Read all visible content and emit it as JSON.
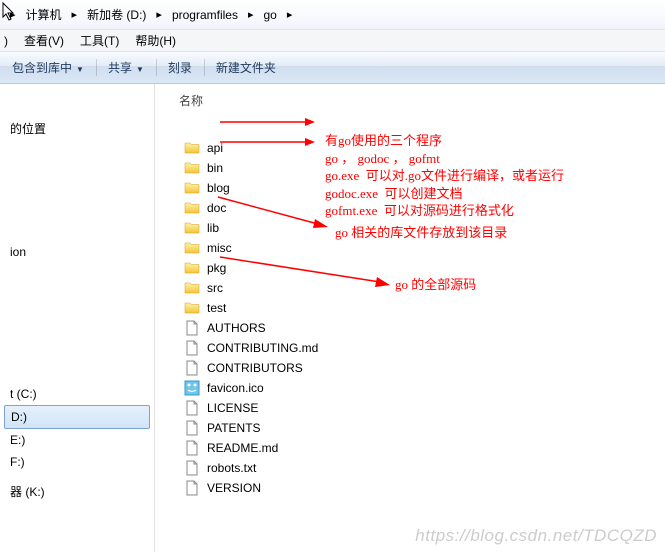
{
  "breadcrumb": [
    {
      "label": "计算机"
    },
    {
      "label": "新加卷 (D:)"
    },
    {
      "label": "programfiles"
    },
    {
      "label": "go"
    }
  ],
  "menubar": {
    "view": "查看(V)",
    "tools": "工具(T)",
    "help": "帮助(H)"
  },
  "toolbar": {
    "include": "包含到库中",
    "share": "共享",
    "burn": "刻录",
    "newfolder": "新建文件夹"
  },
  "sidebar": {
    "items": [
      {
        "label": "的位置",
        "indent": 0
      },
      {
        "label": "ion",
        "indent": 0
      },
      {
        "label": "t (C:)",
        "indent": 0
      },
      {
        "label": "D:)",
        "indent": 0,
        "selected": true
      },
      {
        "label": "E:)",
        "indent": 0
      },
      {
        "label": "F:)",
        "indent": 0
      },
      {
        "label": "器 (K:)",
        "indent": 0
      }
    ]
  },
  "column_header": "名称",
  "files": [
    {
      "name": "api",
      "type": "folder"
    },
    {
      "name": "bin",
      "type": "folder"
    },
    {
      "name": "blog",
      "type": "folder"
    },
    {
      "name": "doc",
      "type": "folder"
    },
    {
      "name": "lib",
      "type": "folder"
    },
    {
      "name": "misc",
      "type": "folder"
    },
    {
      "name": "pkg",
      "type": "folder"
    },
    {
      "name": "src",
      "type": "folder"
    },
    {
      "name": "test",
      "type": "folder"
    },
    {
      "name": "AUTHORS",
      "type": "file"
    },
    {
      "name": "CONTRIBUTING.md",
      "type": "file"
    },
    {
      "name": "CONTRIBUTORS",
      "type": "file"
    },
    {
      "name": "favicon.ico",
      "type": "ico"
    },
    {
      "name": "LICENSE",
      "type": "file"
    },
    {
      "name": "PATENTS",
      "type": "file"
    },
    {
      "name": "README.md",
      "type": "file"
    },
    {
      "name": "robots.txt",
      "type": "file"
    },
    {
      "name": "VERSION",
      "type": "file"
    }
  ],
  "annotations": {
    "bin_block": "有go使用的三个程序\ngo ， godoc ， gofmt\ngo.exe  可以对.go文件进行编译，或者运行\ngodoc.exe  可以创建文档\ngofmt.exe  可以对源码进行格式化",
    "lib_line": "go 相关的库文件存放到该目录",
    "src_line": "go 的全部源码"
  },
  "watermark": "https://blog.csdn.net/TDCQZD"
}
